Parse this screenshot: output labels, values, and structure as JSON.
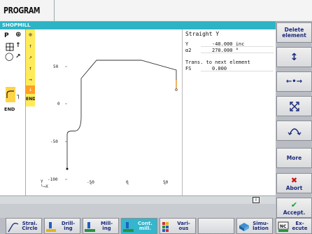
{
  "header": {
    "title": "PROGRAM",
    "subtitle": "SHOPMILL"
  },
  "left_column": {
    "items": [
      "P",
      "⊕",
      "◯",
      "┐",
      "END"
    ],
    "selected": "┐"
  },
  "yellow_column": {
    "items": [
      "⊕",
      "↑",
      "↗",
      "↑",
      "→",
      "↓"
    ],
    "end_label": "END"
  },
  "graph": {
    "y_label": "Y",
    "x_label": "└→X",
    "y_ticks": [
      "50",
      "0",
      "-50",
      "-100"
    ],
    "x_ticks": [
      "-50",
      "0",
      "50"
    ]
  },
  "params": {
    "title": "Straight Y",
    "rows": [
      {
        "name": "Y",
        "value": "-40.000 inc"
      },
      {
        "name": "α2",
        "value": "270.000 °"
      }
    ],
    "transition_label": "Trans. to next element",
    "fs_name": "FS",
    "fs_value": "0.000"
  },
  "softkeys_right": {
    "delete": "Delete\nelement",
    "vertical": "↕",
    "horizontal": "←•→",
    "diagonal": "⤡",
    "arc": "⌒",
    "more": "More",
    "abort": "Abort",
    "abort_icon": "✖",
    "accept": "Accept.",
    "accept_icon": "✔"
  },
  "softkeys_bottom": [
    {
      "line1": "Strai.",
      "line2": "Circle"
    },
    {
      "line1": "Drill-",
      "line2": "ing"
    },
    {
      "line1": "Mill-",
      "line2": "ing"
    },
    {
      "line1": "Cont.",
      "line2": "mill."
    },
    {
      "line1": "Vari-",
      "line2": "ous"
    },
    {
      "line1": "Simu-",
      "line2": "lation"
    },
    {
      "line1": "Ex-",
      "line2": "ecute"
    }
  ],
  "info_icon": "i",
  "colors": {
    "accent": "#2db3c4",
    "softkey_text": "#1b2a7a",
    "highlight": "#ffd44a",
    "orange": "#ffa020"
  }
}
